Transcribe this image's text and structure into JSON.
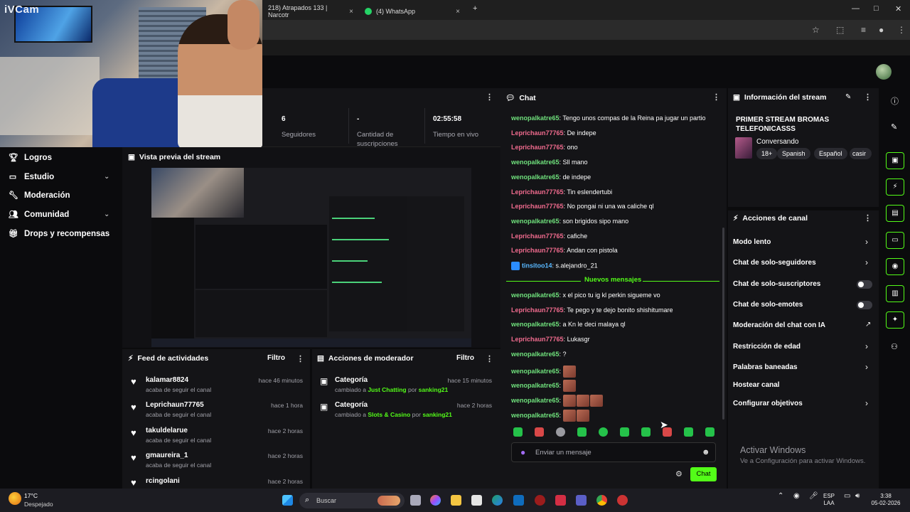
{
  "browser": {
    "tab1": "218) Atrapados 133 | Narcotr",
    "tab2": "(4) WhatsApp",
    "close": "×",
    "newtab": "+",
    "minimize": "—",
    "maximize": "□",
    "winclose": "✕"
  },
  "webcam": {
    "logo": "iVCam"
  },
  "stats": [
    {
      "value": "6",
      "label": "Seguidores"
    },
    {
      "value": "-",
      "label": "Cantidad de suscripciones"
    },
    {
      "value": "02:55:58",
      "label": "Tiempo en vivo"
    }
  ],
  "nav": [
    {
      "label": "Logros",
      "icon": "trophy-icon"
    },
    {
      "label": "Estudio",
      "icon": "tv-icon",
      "expandable": true
    },
    {
      "label": "Moderación",
      "icon": "wrench-icon"
    },
    {
      "label": "Comunidad",
      "icon": "people-icon",
      "expandable": true
    },
    {
      "label": "Drops y recompensas",
      "icon": "gift-icon"
    }
  ],
  "preview": {
    "title": "Vista previa del stream"
  },
  "feed": {
    "title": "Feed de actividades",
    "filter": "Filtro",
    "items": [
      {
        "name": "kalamar8824",
        "sub": "acaba de seguir el canal",
        "time": "hace 46 minutos"
      },
      {
        "name": "Leprichaun77765",
        "sub": "acaba de seguir el canal",
        "time": "hace 1 hora"
      },
      {
        "name": "takuldelarue",
        "sub": "acaba de seguir el canal",
        "time": "hace 2 horas"
      },
      {
        "name": "gmaureira_1",
        "sub": "acaba de seguir el canal",
        "time": "hace 2 horas"
      },
      {
        "name": "rcingolani",
        "sub": "",
        "time": "hace 2 horas"
      }
    ]
  },
  "modactions": {
    "title": "Acciones de moderador",
    "filter": "Filtro",
    "items": [
      {
        "name": "Categoría",
        "pre": "cambiado a ",
        "cat": "Just Chatting",
        "mid": " por ",
        "by": "sanking21",
        "time": "hace 15 minutos"
      },
      {
        "name": "Categoría",
        "pre": "cambiado a ",
        "cat": "Slots & Casino",
        "mid": " por ",
        "by": "sanking21",
        "time": "hace 2 horas"
      }
    ]
  },
  "chat": {
    "title": "Chat",
    "new_messages": "Nuevos mensajes",
    "messages_before": [
      {
        "user": "wenopalkatre65",
        "color": "g",
        "text": "Tengo unos compas de la Reina pa jugar un partio"
      },
      {
        "user": "Leprichaun77765",
        "color": "p",
        "text": "De indepe"
      },
      {
        "user": "Leprichaun77765",
        "color": "p",
        "text": "ono"
      },
      {
        "user": "wenopalkatre65",
        "color": "g",
        "text": "Sll mano"
      },
      {
        "user": "wenopalkatre65",
        "color": "g",
        "text": "de indepe"
      },
      {
        "user": "Leprichaun77765",
        "color": "p",
        "text": "Tin eslendertubi"
      },
      {
        "user": "Leprichaun77765",
        "color": "p",
        "text": "No pongai ni una wa caliche ql"
      },
      {
        "user": "wenopalkatre65",
        "color": "g",
        "text": "son brigidos sipo mano"
      },
      {
        "user": "Leprichaun77765",
        "color": "p",
        "text": "cafiche"
      },
      {
        "user": "Leprichaun77765",
        "color": "p",
        "text": "Andan con pistola"
      },
      {
        "user": "tinsitoo14",
        "color": "b",
        "text": "s.alejandro_21"
      }
    ],
    "messages_after": [
      {
        "user": "wenopalkatre65",
        "color": "g",
        "text": "x el pico tu ig kl perkin sigueme vo"
      },
      {
        "user": "Leprichaun77765",
        "color": "p",
        "text": "Te pego y te dejo bonito shishitumare"
      },
      {
        "user": "wenopalkatre65",
        "color": "g",
        "text": "a Kn le deci malaya ql"
      },
      {
        "user": "Leprichaun77765",
        "color": "p",
        "text": "Lukasgr"
      },
      {
        "user": "wenopalkatre65",
        "color": "g",
        "text": "?"
      },
      {
        "user": "wenopalkatre65",
        "color": "g",
        "text": "",
        "emotes": 1
      },
      {
        "user": "wenopalkatre65",
        "color": "g",
        "text": "",
        "emotes": 1
      },
      {
        "user": "wenopalkatre65",
        "color": "g",
        "text": "",
        "emotes": 3
      },
      {
        "user": "wenopalkatre65",
        "color": "g",
        "text": "",
        "emotes": 2
      }
    ],
    "placeholder": "Enviar un mensaje",
    "send": "Chat"
  },
  "info": {
    "title": "Información del stream",
    "stream_title": "PRIMER STREAM BROMAS TELEFONICASSS",
    "category": "Conversando",
    "tags": [
      "18+",
      "Spanish",
      "Español",
      "casir"
    ]
  },
  "actions": {
    "title": "Acciones de canal",
    "items": [
      {
        "label": "Modo lento",
        "control": "chevron"
      },
      {
        "label": "Chat de solo-seguidores",
        "control": "chevron"
      },
      {
        "label": "Chat de solo-suscriptores",
        "control": "toggle"
      },
      {
        "label": "Chat de solo-emotes",
        "control": "toggle"
      },
      {
        "label": "Moderación del chat con IA",
        "control": "external"
      },
      {
        "label": "Restricción de edad",
        "control": "chevron"
      },
      {
        "label": "Palabras baneadas",
        "control": "chevron"
      },
      {
        "label": "Hostear canal",
        "control": "none"
      },
      {
        "label": "Configurar objetivos",
        "control": "chevron"
      }
    ]
  },
  "watermark": {
    "line1": "Activar Windows",
    "line2": "Ve a Configuración para activar Windows."
  },
  "taskbar": {
    "temp": "17°C",
    "weather": "Despejado",
    "search": "Buscar",
    "lang1": "ESP",
    "lang2": "LAA",
    "time": "3:38",
    "date": "05-02-2026"
  }
}
